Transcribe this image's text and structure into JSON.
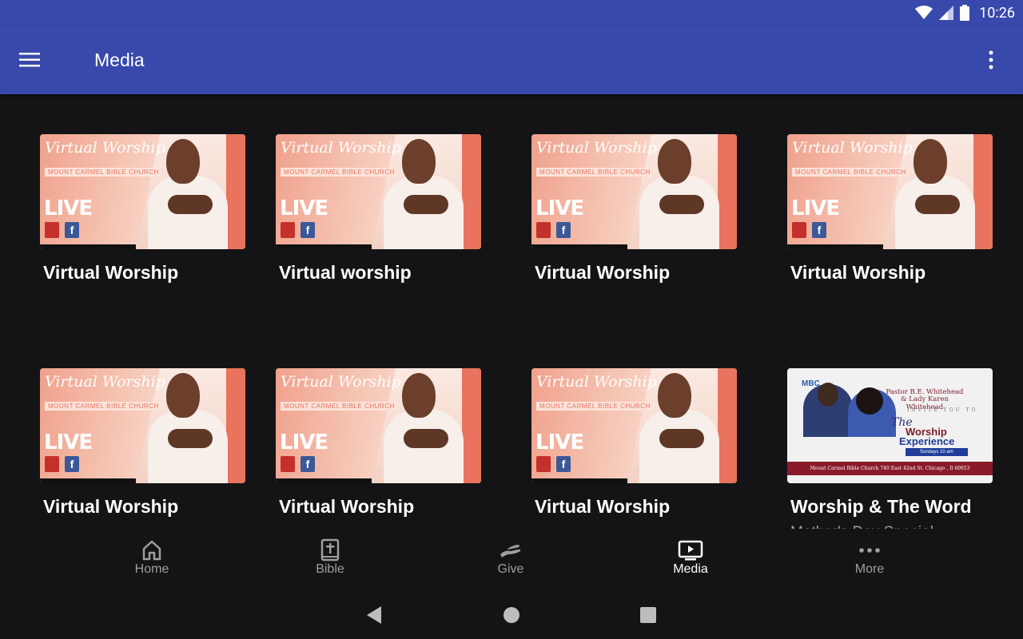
{
  "status": {
    "time": "10:26"
  },
  "appbar": {
    "title": "Media"
  },
  "cards": [
    {
      "title": "Virtual Worship",
      "thumb": "virtual-worship"
    },
    {
      "title": "Virtual worship",
      "thumb": "virtual-worship"
    },
    {
      "title": "Virtual Worship",
      "thumb": "virtual-worship"
    },
    {
      "title": "Virtual Worship",
      "thumb": "virtual-worship"
    },
    {
      "title": "Virtual Worship",
      "thumb": "virtual-worship"
    },
    {
      "title": "Virtual Worship",
      "thumb": "virtual-worship"
    },
    {
      "title": "Virtual Worship",
      "thumb": "virtual-worship"
    },
    {
      "title": "Worship & The Word",
      "subtitle": "Mother's Day Special",
      "thumb": "worship-experience"
    }
  ],
  "thumbs": {
    "virtual_worship": {
      "script": "Virtual Worship",
      "church": "MOUNT CARMEL BIBLE CHURCH",
      "live": "LIVE",
      "youtube": "You Tube",
      "facebook": "f"
    },
    "worship_experience": {
      "logo": "MBC",
      "pastor": "Pastor B.E. Whitehead & Lady Karen Whitehead",
      "invite": "INVITE YOU TO",
      "the": "The",
      "worship": "Worship",
      "experience": "Experience",
      "sundays": "Sundays 10 am",
      "footer": "Mount Carmel Bible Church 740 East 42nd St. Chicago , Il 60653"
    }
  },
  "nav": {
    "items": [
      {
        "label": "Home",
        "icon": "home-icon"
      },
      {
        "label": "Bible",
        "icon": "bible-icon"
      },
      {
        "label": "Give",
        "icon": "give-icon"
      },
      {
        "label": "Media",
        "icon": "media-icon",
        "active": true
      },
      {
        "label": "More",
        "icon": "more-icon"
      }
    ]
  },
  "colors": {
    "appbar": "#3949ab",
    "background": "#141416",
    "accent_thumb": "#e9735d"
  }
}
